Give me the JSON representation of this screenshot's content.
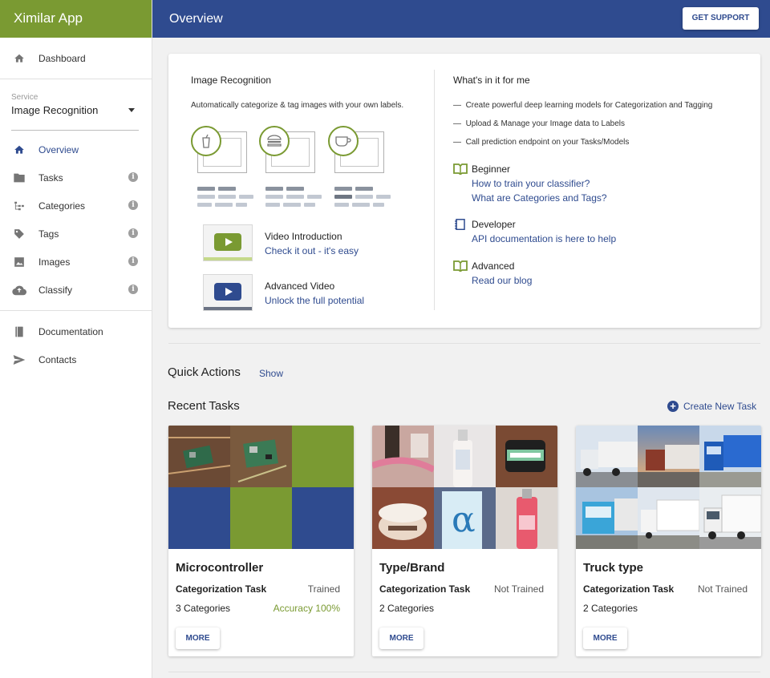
{
  "app": {
    "brand": "Ximilar App",
    "title": "Overview",
    "support_label": "GET SUPPORT"
  },
  "sidebar": {
    "dashboard": "Dashboard",
    "service_label": "Service",
    "service_value": "Image Recognition",
    "items": [
      {
        "label": "Overview",
        "icon": "home-icon",
        "active": true
      },
      {
        "label": "Tasks",
        "icon": "folder-icon"
      },
      {
        "label": "Categories",
        "icon": "tree-icon"
      },
      {
        "label": "Tags",
        "icon": "tag-icon"
      },
      {
        "label": "Images",
        "icon": "image-icon"
      },
      {
        "label": "Classify",
        "icon": "cloud-upload-icon"
      }
    ],
    "documentation": "Documentation",
    "contacts": "Contacts"
  },
  "overview": {
    "left_title": "Image Recognition",
    "left_desc": "Automatically categorize & tag images with your own labels.",
    "video1_title": "Video Introduction",
    "video1_link": "Check it out - it's easy",
    "video2_title": "Advanced Video",
    "video2_link": "Unlock the full potential",
    "right_title": "What's in it for me",
    "bullets": [
      "Create powerful deep learning models for Categorization and Tagging",
      "Upload & Manage your Image data to Labels",
      "Call prediction endpoint on your Tasks/Models"
    ],
    "beginner_title": "Beginner",
    "beginner_links": [
      "How to train your classifier?",
      "What are Categories and Tags?"
    ],
    "developer_title": "Developer",
    "developer_link": "API documentation is here to help",
    "advanced_title": "Advanced",
    "advanced_link": "Read our blog"
  },
  "quick_actions": {
    "title": "Quick Actions",
    "show": "Show"
  },
  "recent_tasks": {
    "title": "Recent Tasks",
    "create": "Create New Task",
    "more_label": "MORE",
    "tasks": [
      {
        "name": "Microcontroller",
        "type": "Categorization Task",
        "status": "Trained",
        "categories": "3 Categories",
        "accuracy": "Accuracy 100%"
      },
      {
        "name": "Type/Brand",
        "type": "Categorization Task",
        "status": "Not Trained",
        "categories": "2 Categories",
        "accuracy": ""
      },
      {
        "name": "Truck type",
        "type": "Categorization Task",
        "status": "Not Trained",
        "categories": "2 Categories",
        "accuracy": ""
      }
    ]
  },
  "colors": {
    "brand_green": "#7a9a32",
    "brand_blue": "#2f4b8f"
  }
}
